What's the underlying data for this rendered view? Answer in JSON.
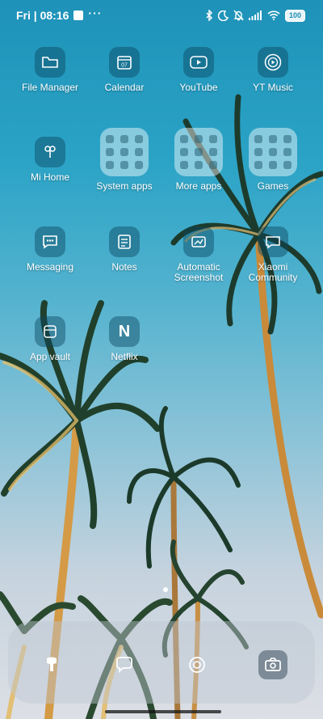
{
  "status_bar": {
    "time": "Fri | 08:16",
    "overflow": "···",
    "battery": "100",
    "icons": [
      "bluetooth-icon",
      "moon-icon",
      "bell-off-icon",
      "signal-icon",
      "wifi-icon",
      "battery-icon"
    ]
  },
  "apps": [
    {
      "label": "File Manager",
      "icon": "folder-icon"
    },
    {
      "label": "Calendar",
      "icon": "calendar-icon",
      "badge": "07"
    },
    {
      "label": "YouTube",
      "icon": "youtube-icon"
    },
    {
      "label": "YT Music",
      "icon": "yt-music-icon"
    },
    {
      "label": "Mi Home",
      "icon": "mi-home-icon"
    },
    {
      "label": "System apps",
      "icon": "folder-grid"
    },
    {
      "label": "More apps",
      "icon": "folder-grid"
    },
    {
      "label": "Games",
      "icon": "folder-grid"
    },
    {
      "label": "Messaging",
      "icon": "messaging-icon"
    },
    {
      "label": "Notes",
      "icon": "notes-icon"
    },
    {
      "label": "Automatic\nScreenshot",
      "icon": "screenshot-icon"
    },
    {
      "label": "Xiaomi\nCommunity",
      "icon": "xiaomi-community-icon"
    },
    {
      "label": "App vault",
      "icon": "app-vault-icon"
    },
    {
      "label": "Netflix",
      "icon": "netflix-icon",
      "glyph": "N"
    }
  ],
  "dock": [
    "phone-icon",
    "chat-icon",
    "browser-icon",
    "camera-icon"
  ],
  "colors": {
    "sky_top": "#1e92b8",
    "sky_bottom": "#dcdfe5",
    "icon_bg": "#0a465f"
  }
}
